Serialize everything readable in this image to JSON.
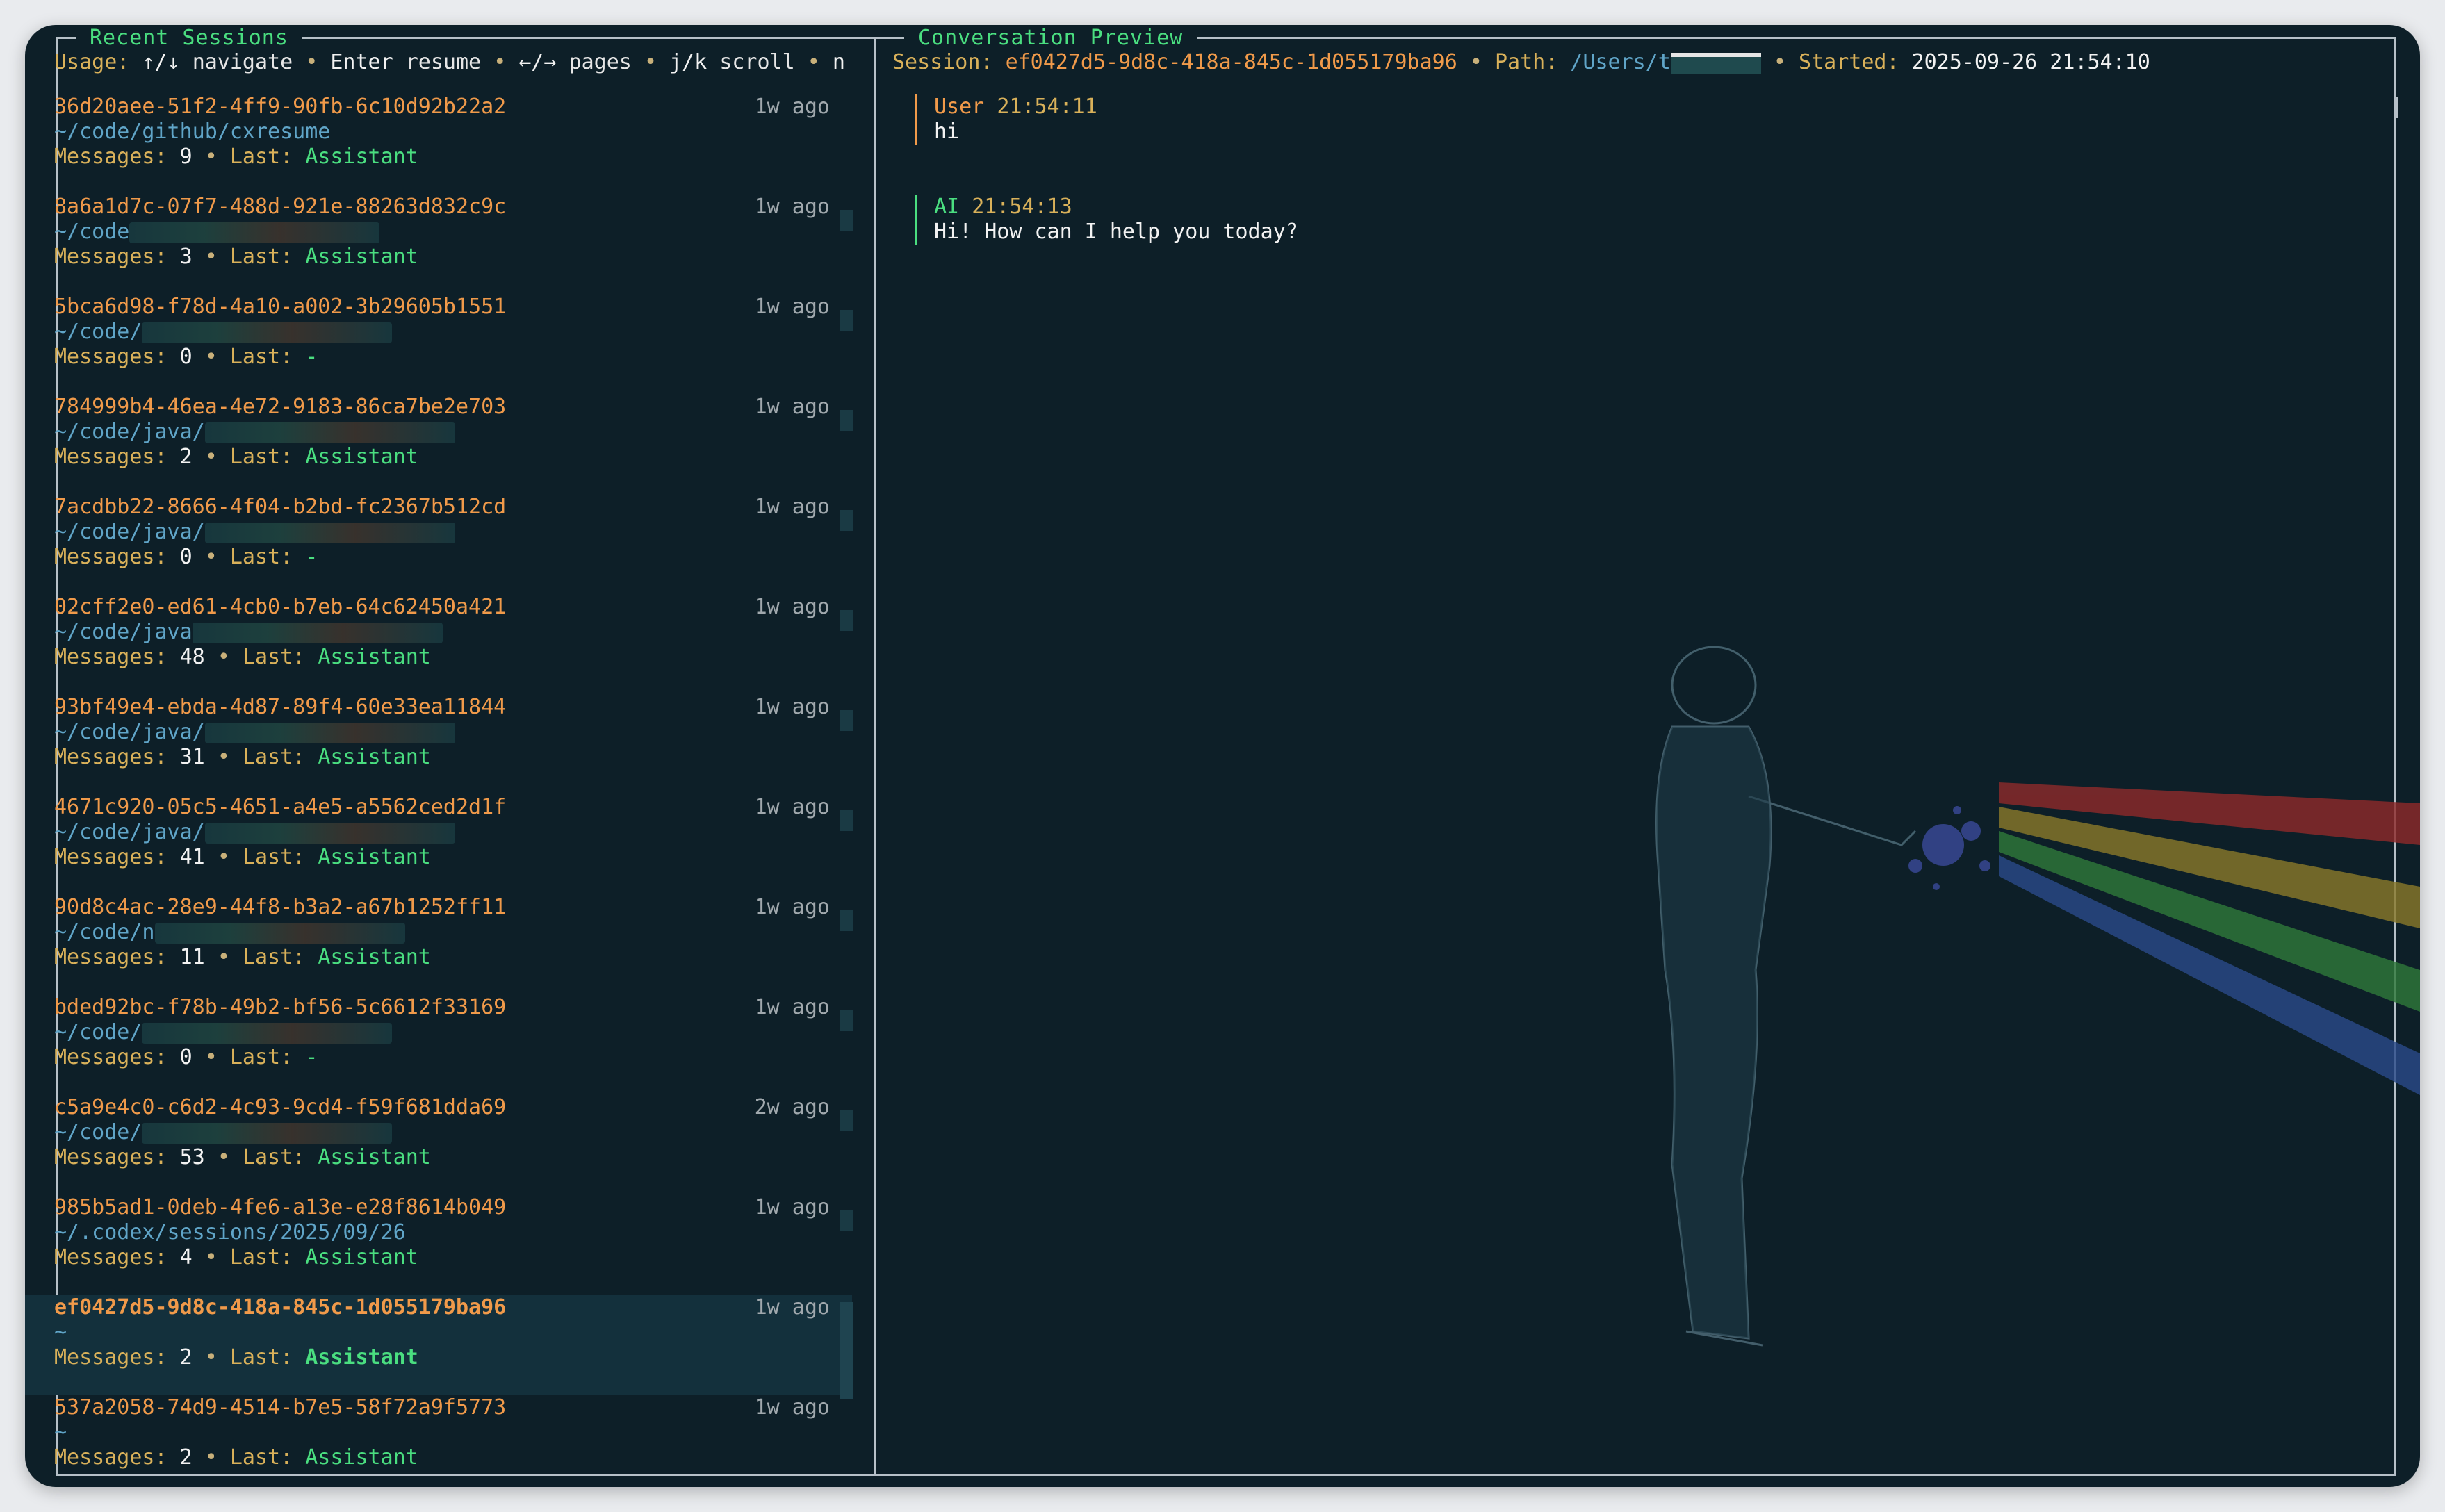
{
  "left_panel": {
    "title": "Recent Sessions",
    "usage": {
      "label": "Usage:",
      "k1": "↑/↓",
      "t1": "navigate",
      "k2": "Enter",
      "t2": "resume",
      "k3": "←/→",
      "t3": "pages",
      "k4": "j/k",
      "t4": "scroll",
      "k5": "n"
    }
  },
  "sessions": [
    {
      "id": "36d20aee-51f2-4ff9-90fb-6c10d92b22a2",
      "ago": "1w ago",
      "path": "~/code/github/cxresume",
      "messages": "9",
      "last": "Assistant"
    },
    {
      "id": "8a6a1d7c-07f7-488d-921e-88263d832c9c",
      "ago": "1w ago",
      "path": "~/code",
      "messages": "3",
      "last": "Assistant"
    },
    {
      "id": "5bca6d98-f78d-4a10-a002-3b29605b1551",
      "ago": "1w ago",
      "path": "~/code/",
      "messages": "0",
      "last": "-"
    },
    {
      "id": "784999b4-46ea-4e72-9183-86ca7be2e703",
      "ago": "1w ago",
      "path": "~/code/java/",
      "messages": "2",
      "last": "Assistant"
    },
    {
      "id": "7acdbb22-8666-4f04-b2bd-fc2367b512cd",
      "ago": "1w ago",
      "path": "~/code/java/",
      "messages": "0",
      "last": "-"
    },
    {
      "id": "02cff2e0-ed61-4cb0-b7eb-64c62450a421",
      "ago": "1w ago",
      "path": "~/code/java",
      "messages": "48",
      "last": "Assistant"
    },
    {
      "id": "93bf49e4-ebda-4d87-89f4-60e33ea11844",
      "ago": "1w ago",
      "path": "~/code/java/",
      "messages": "31",
      "last": "Assistant"
    },
    {
      "id": "4671c920-05c5-4651-a4e5-a5562ced2d1f",
      "ago": "1w ago",
      "path": "~/code/java/",
      "messages": "41",
      "last": "Assistant"
    },
    {
      "id": "90d8c4ac-28e9-44f8-b3a2-a67b1252ff11",
      "ago": "1w ago",
      "path": "~/code/n",
      "messages": "11",
      "last": "Assistant"
    },
    {
      "id": "bded92bc-f78b-49b2-bf56-5c6612f33169",
      "ago": "1w ago",
      "path": "~/code/",
      "messages": "0",
      "last": "-"
    },
    {
      "id": "c5a9e4c0-c6d2-4c93-9cd4-f59f681dda69",
      "ago": "2w ago",
      "path": "~/code/",
      "messages": "53",
      "last": "Assistant"
    },
    {
      "id": "985b5ad1-0deb-4fe6-a13e-e28f8614b049",
      "ago": "1w ago",
      "path": "~/.codex/sessions/2025/09/26",
      "messages": "4",
      "last": "Assistant"
    },
    {
      "id": "ef0427d5-9d8c-418a-845c-1d055179ba96",
      "ago": "1w ago",
      "path": "~",
      "messages": "2",
      "last": "Assistant",
      "selected": true
    },
    {
      "id": "537a2058-74d9-4514-b7e5-58f72a9f5773",
      "ago": "1w ago",
      "path": "~",
      "messages": "2",
      "last": "Assistant"
    }
  ],
  "labels": {
    "messages": "Messages:",
    "last": "Last:",
    "dot": "•"
  },
  "right_panel": {
    "title": "Conversation Preview",
    "session_label": "Session:",
    "session_id": "ef0427d5-9d8c-418a-845c-1d055179ba96",
    "path_label": "Path:",
    "path_value": "/Users/t",
    "started_label": "Started:",
    "started_value": "2025-09-26 21:54:10",
    "messages": [
      {
        "role": "User",
        "time": "21:54:11",
        "text": "hi"
      },
      {
        "role": "AI",
        "time": "21:54:13",
        "text": "Hi! How can I help you today?"
      }
    ]
  },
  "colors": {
    "background": "#0d1f28",
    "accent_green": "#4ade80",
    "accent_orange": "#f09a4a",
    "label_gold": "#d9b15a",
    "path_blue": "#60a5c8"
  }
}
